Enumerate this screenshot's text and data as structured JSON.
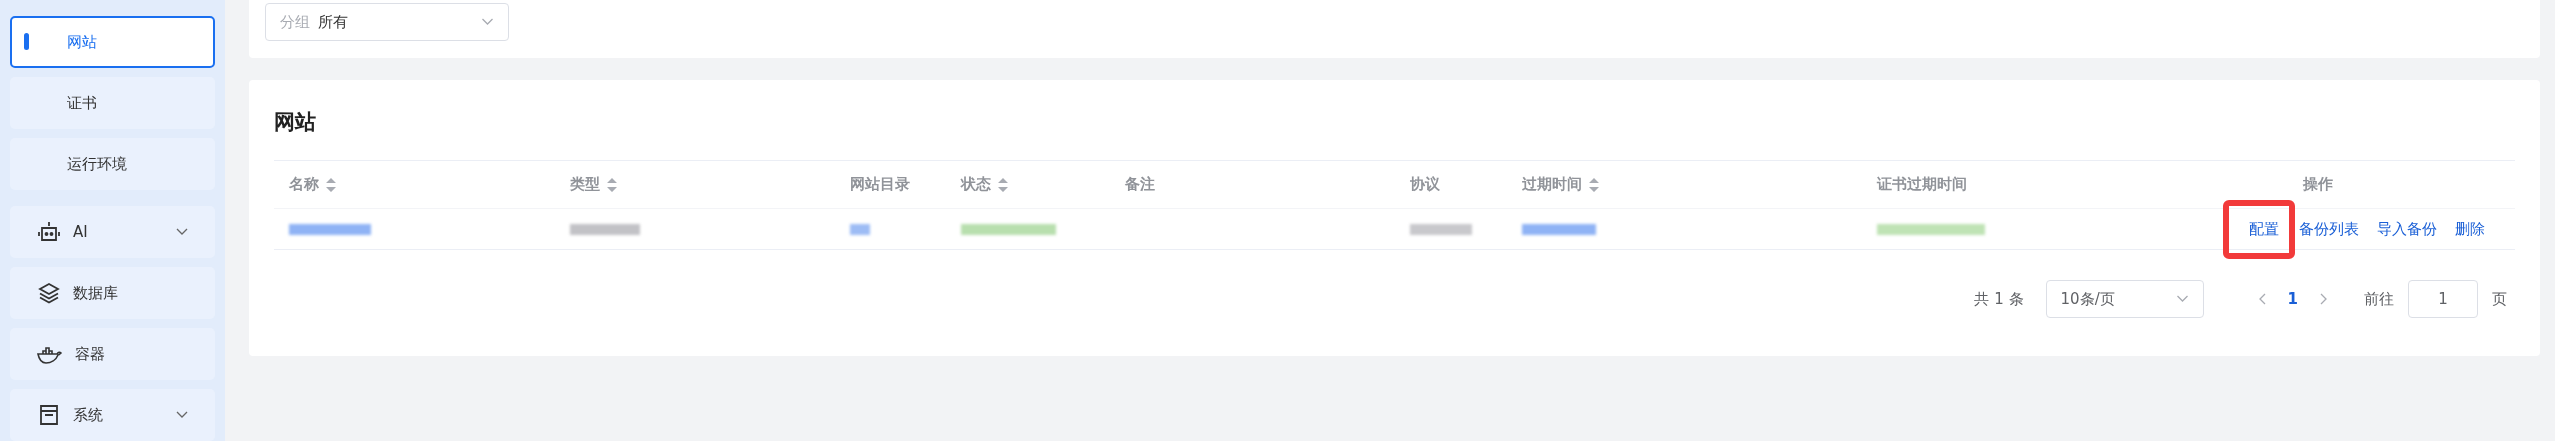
{
  "sidebar": {
    "items": [
      {
        "kind": "sub",
        "label": "网站",
        "selected": true
      },
      {
        "kind": "sub",
        "label": "证书",
        "selected": false
      },
      {
        "kind": "sub",
        "label": "运行环境",
        "selected": false
      },
      {
        "kind": "main",
        "label": "AI",
        "expanded": false,
        "selected": false
      },
      {
        "kind": "main",
        "label": "数据库",
        "selected": false
      },
      {
        "kind": "main",
        "label": "容器",
        "selected": false
      },
      {
        "kind": "main",
        "label": "系统",
        "expanded": false,
        "selected": false
      }
    ]
  },
  "filter": {
    "label": "分组",
    "value": "所有"
  },
  "table": {
    "title": "网站",
    "columns": [
      {
        "label": "名称",
        "sortable": true
      },
      {
        "label": "类型",
        "sortable": true
      },
      {
        "label": "网站目录",
        "sortable": false
      },
      {
        "label": "状态",
        "sortable": true
      },
      {
        "label": "备注",
        "sortable": false
      },
      {
        "label": "协议",
        "sortable": false
      },
      {
        "label": "过期时间",
        "sortable": true
      },
      {
        "label": "证书过期时间",
        "sortable": false
      },
      {
        "label": "操作",
        "sortable": false
      }
    ],
    "rows": [
      {
        "cells": [
          {
            "kind": "blurred",
            "color": "#8fb3f5"
          },
          {
            "kind": "blurred",
            "color": "#c2c2c6"
          },
          {
            "kind": "blurred",
            "color": "#9dbcf5"
          },
          {
            "kind": "blurred",
            "color": "#b8dfae"
          },
          {
            "kind": "empty"
          },
          {
            "kind": "blurred",
            "color": "#c8c8cc"
          },
          {
            "kind": "blurred",
            "color": "#8fb3f5"
          },
          {
            "kind": "blurred",
            "color": "#bfe3b5"
          },
          {
            "kind": "actions",
            "actions": [
              {
                "label": "配置",
                "highlighted": true
              },
              {
                "label": "备份列表",
                "highlighted": false
              },
              {
                "label": "导入备份",
                "highlighted": false
              },
              {
                "label": "删除",
                "highlighted": false
              }
            ]
          }
        ]
      }
    ]
  },
  "pagination": {
    "total": "共 1 条",
    "page_size": "10条/页",
    "pages": [
      {
        "label": "1",
        "selected": true
      }
    ],
    "goto_label": "前往",
    "goto_value": "1",
    "goto_suffix": "页"
  }
}
